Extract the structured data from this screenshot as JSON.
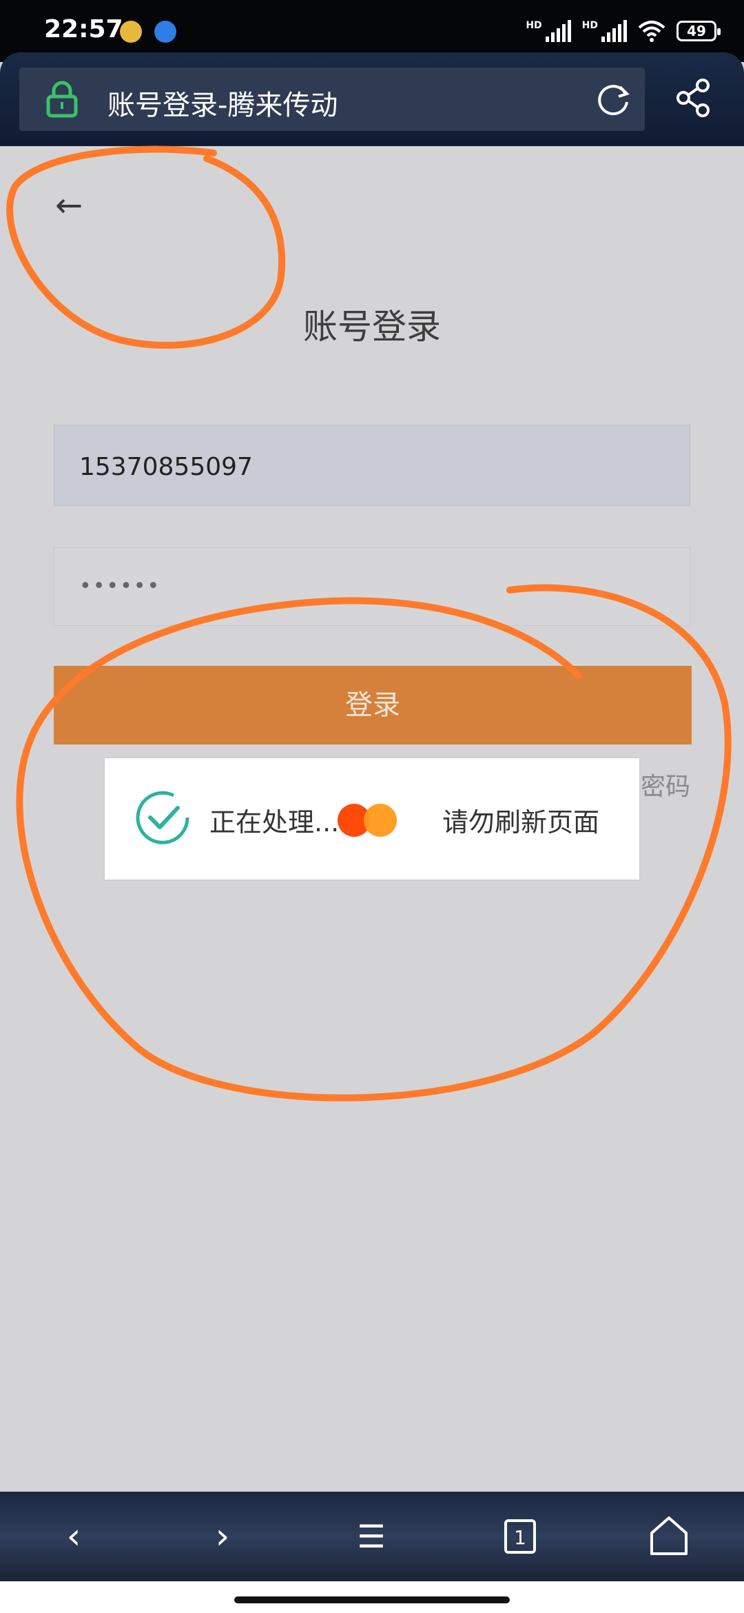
{
  "status_bar": {
    "time": "22:57",
    "network_left": "HD",
    "network_right": "HD",
    "battery": "49"
  },
  "browser": {
    "page_title": "账号登录-腾来传动",
    "tab_count": "1"
  },
  "page": {
    "back_icon": "←",
    "title": "账号登录",
    "phone_value": "15370855097",
    "password_value": "••••••",
    "login_label": "登录",
    "forgot_label": "密码"
  },
  "toast": {
    "status": "正在处理...",
    "note": "请勿刷新页面"
  },
  "nav": {
    "back": "‹",
    "forward": "›",
    "menu": "☰"
  },
  "colors": {
    "accent": "#d5813b",
    "annotation": "#ff7a2a",
    "check": "#2db39e"
  },
  "icons": [
    "lock-icon",
    "reload-icon",
    "share-icon",
    "check-icon",
    "back-arrow-icon",
    "home-icon",
    "tabs-icon"
  ]
}
